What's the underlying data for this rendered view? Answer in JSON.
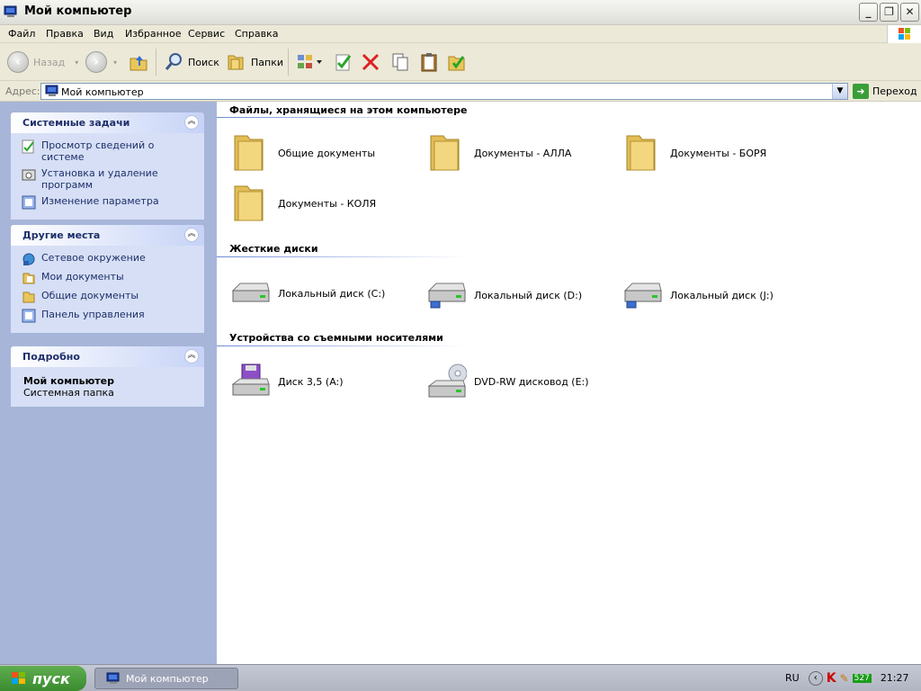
{
  "window": {
    "title": "Мой компьютер"
  },
  "menu": [
    "Файл",
    "Правка",
    "Вид",
    "Избранное",
    "Сервис",
    "Справка"
  ],
  "toolbar": {
    "back": "Назад",
    "search": "Поиск",
    "folders": "Папки"
  },
  "address": {
    "label": "Адрес:",
    "value": "Мой компьютер",
    "go": "Переход"
  },
  "tasks": {
    "system": {
      "title": "Системные задачи",
      "items": [
        "Просмотр сведений о системе",
        "Установка и удаление программ",
        "Изменение параметра"
      ]
    },
    "places": {
      "title": "Другие места",
      "items": [
        "Сетевое окружение",
        "Мои документы",
        "Общие документы",
        "Панель управления"
      ]
    },
    "details": {
      "title": "Подробно",
      "name": "Мой компьютер",
      "type": "Системная папка"
    }
  },
  "groups": {
    "files": {
      "title": "Файлы, хранящиеся на этом компьютере",
      "items": [
        "Общие документы",
        "Документы - АЛЛА",
        "Документы - БОРЯ",
        "Документы - КОЛЯ"
      ]
    },
    "disks": {
      "title": "Жесткие диски",
      "items": [
        "Локальный диск (C:)",
        "Локальный диск (D:)",
        "Локальный диск (J:)"
      ]
    },
    "removable": {
      "title": "Устройства со съемными носителями",
      "items": [
        "Диск 3,5 (A:)",
        "DVD-RW дисковод (E:)"
      ]
    }
  },
  "taskbar": {
    "start": "пуск",
    "window": "Мой компьютер",
    "lang": "RU",
    "tray_count": "527",
    "clock": "21:27"
  }
}
